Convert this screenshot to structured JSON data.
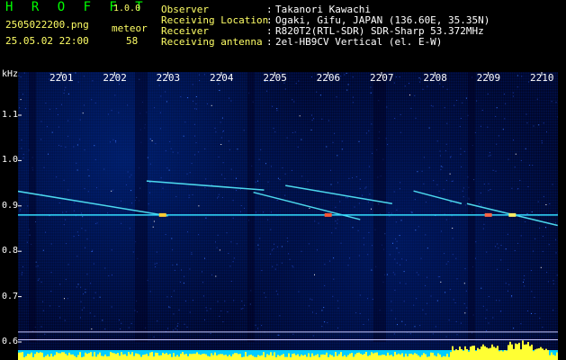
{
  "header": {
    "app_title": "H R O F F T",
    "app_version": "1.0.0",
    "file_name": "2505022200.png",
    "datetime": "25.05.02 22:00",
    "count_label": "meteor",
    "count_value": "58"
  },
  "info": [
    {
      "label": "Observer",
      "value": "Takanori Kawachi"
    },
    {
      "label": "Receiving Location",
      "value": "Ogaki, Gifu, JAPAN (136.60E, 35.35N)"
    },
    {
      "label": "Receiver",
      "value": "R820T2(RTL-SDR) SDR-Sharp 53.372MHz"
    },
    {
      "label": "Receiving antenna",
      "value": "2el-HB9CV Vertical (el. E-W)"
    }
  ],
  "colon": ":",
  "chart_data": {
    "type": "heatmap",
    "ylabel": "kHz",
    "ylim": [
      0.6,
      1.15
    ],
    "yticks": [
      "1.1",
      "1.0",
      "0.9",
      "0.8",
      "0.7",
      "0.6"
    ],
    "ytick_values": [
      1.1,
      1.0,
      0.9,
      0.8,
      0.7,
      0.6
    ],
    "xticks": [
      "2201",
      "2202",
      "2203",
      "2204",
      "2205",
      "2206",
      "2207",
      "2208",
      "2209",
      "2210"
    ],
    "xtick_minutes": [
      1,
      2,
      3,
      4,
      5,
      6,
      7,
      8,
      9,
      10
    ],
    "xlim": [
      0.15,
      10.3
    ],
    "carrier_khz": 0.88,
    "traces": [
      {
        "x0": 0.15,
        "y0": 0.933,
        "x1": 3.0,
        "y1": 0.878
      },
      {
        "x0": 2.6,
        "y0": 0.955,
        "x1": 4.8,
        "y1": 0.935
      },
      {
        "x0": 4.6,
        "y0": 0.93,
        "x1": 6.6,
        "y1": 0.87
      },
      {
        "x0": 5.2,
        "y0": 0.945,
        "x1": 7.2,
        "y1": 0.905
      },
      {
        "x0": 7.6,
        "y0": 0.933,
        "x1": 8.5,
        "y1": 0.905
      },
      {
        "x0": 8.6,
        "y0": 0.905,
        "x1": 10.3,
        "y1": 0.857
      }
    ],
    "ref_lines_khz": [
      0.622,
      0.605
    ],
    "colors": {
      "green_text": "#00ff00",
      "carrier": "#33ddff",
      "trace": "#55eeff",
      "ref_line": "#c8c8ff",
      "level_bars": "#ffff33",
      "base_band": "#00ccff"
    }
  }
}
